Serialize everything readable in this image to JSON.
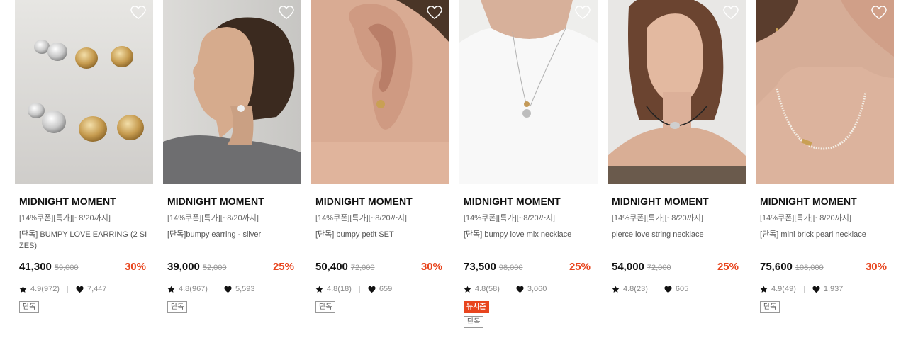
{
  "products": [
    {
      "brand": "MIDNIGHT MOMENT",
      "promo": "[14%쿠폰][특가][~8/20까지]",
      "name": "[단독] BUMPY LOVE EARRING (2 SIZES)",
      "price": "41,300",
      "original_price": "59,000",
      "discount": "30%",
      "rating": "4.9(972)",
      "likes": "7,447",
      "badges": [
        {
          "label": "단독",
          "style": "outline"
        }
      ]
    },
    {
      "brand": "MIDNIGHT MOMENT",
      "promo": "[14%쿠폰][특가][~8/20까지]",
      "name": "[단독]bumpy earring - silver",
      "price": "39,000",
      "original_price": "52,000",
      "discount": "25%",
      "rating": "4.8(967)",
      "likes": "5,593",
      "badges": [
        {
          "label": "단독",
          "style": "outline"
        }
      ]
    },
    {
      "brand": "MIDNIGHT MOMENT",
      "promo": "[14%쿠폰][특가][~8/20까지]",
      "name": "[단독] bumpy petit SET",
      "price": "50,400",
      "original_price": "72,000",
      "discount": "30%",
      "rating": "4.8(18)",
      "likes": "659",
      "badges": [
        {
          "label": "단독",
          "style": "outline"
        }
      ]
    },
    {
      "brand": "MIDNIGHT MOMENT",
      "promo": "[14%쿠폰][특가][~8/20까지]",
      "name": "[단독] bumpy love mix necklace",
      "price": "73,500",
      "original_price": "98,000",
      "discount": "25%",
      "rating": "4.8(58)",
      "likes": "3,060",
      "badges": [
        {
          "label": "뉴시즌",
          "style": "filled"
        },
        {
          "label": "단독",
          "style": "outline"
        }
      ]
    },
    {
      "brand": "MIDNIGHT MOMENT",
      "promo": "[14%쿠폰][특가][~8/20까지]",
      "name": "pierce love string necklace",
      "price": "54,000",
      "original_price": "72,000",
      "discount": "25%",
      "rating": "4.8(23)",
      "likes": "605",
      "badges": []
    },
    {
      "brand": "MIDNIGHT MOMENT",
      "promo": "[14%쿠폰][특가][~8/20까지]",
      "name": "[단독] mini brick pearl necklace",
      "price": "75,600",
      "original_price": "108,000",
      "discount": "30%",
      "rating": "4.9(49)",
      "likes": "1,937",
      "badges": [
        {
          "label": "단독",
          "style": "outline"
        }
      ]
    }
  ],
  "colors": {
    "accent": "#e8451e",
    "muted": "#888888"
  }
}
